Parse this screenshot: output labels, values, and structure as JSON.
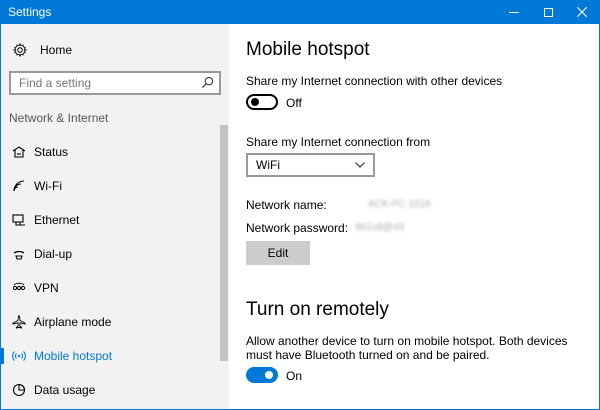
{
  "window": {
    "title": "Settings"
  },
  "sidebar": {
    "home_label": "Home",
    "search_placeholder": "Find a setting",
    "section_label": "Network & Internet",
    "items": [
      {
        "label": "Status",
        "icon": "status-icon"
      },
      {
        "label": "Wi-Fi",
        "icon": "wifi-icon"
      },
      {
        "label": "Ethernet",
        "icon": "ethernet-icon"
      },
      {
        "label": "Dial-up",
        "icon": "dialup-icon"
      },
      {
        "label": "VPN",
        "icon": "vpn-icon"
      },
      {
        "label": "Airplane mode",
        "icon": "airplane-icon"
      },
      {
        "label": "Mobile hotspot",
        "icon": "hotspot-icon",
        "active": true
      },
      {
        "label": "Data usage",
        "icon": "data-usage-icon"
      }
    ]
  },
  "main": {
    "heading": "Mobile hotspot",
    "share_label": "Share my Internet connection with other devices",
    "share_toggle_state": "Off",
    "share_from_label": "Share my Internet connection from",
    "share_from_value": "WiFi",
    "network_name_label": "Network name:",
    "network_name_value": "ACK-PC 1518",
    "network_password_label": "Network password:",
    "network_password_value": "961u8@43",
    "edit_button": "Edit",
    "remote_heading": "Turn on remotely",
    "remote_desc_line1": "Allow another device to turn on mobile hotspot. Both devices",
    "remote_desc_line2": "must have Bluetooth turned on and be paired.",
    "remote_toggle_state": "On"
  },
  "colors": {
    "accent": "#0078d7",
    "sidebar_bg": "#f2f2f2",
    "button_bg": "#cccccc"
  }
}
